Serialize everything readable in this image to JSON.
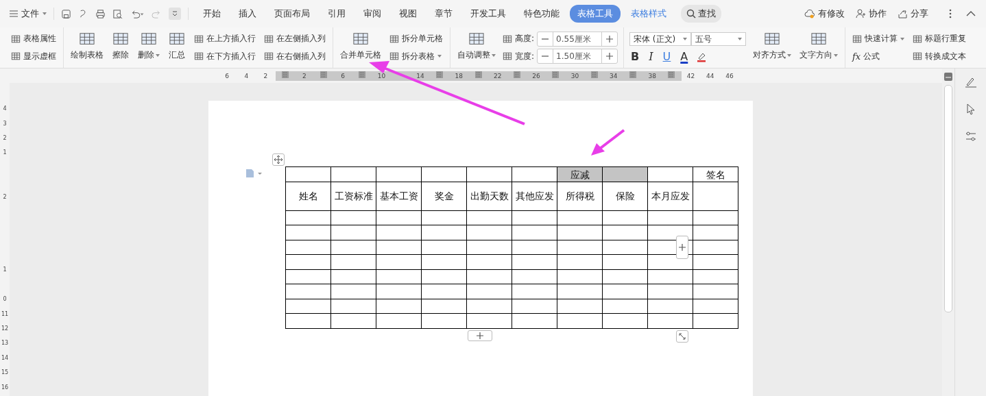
{
  "menu": {
    "file": "文件"
  },
  "tabs": [
    {
      "label": "开始",
      "selected": false,
      "contextual": false
    },
    {
      "label": "插入",
      "selected": false,
      "contextual": false
    },
    {
      "label": "页面布局",
      "selected": false,
      "contextual": false
    },
    {
      "label": "引用",
      "selected": false,
      "contextual": false
    },
    {
      "label": "审阅",
      "selected": false,
      "contextual": false
    },
    {
      "label": "视图",
      "selected": false,
      "contextual": false
    },
    {
      "label": "章节",
      "selected": false,
      "contextual": false
    },
    {
      "label": "开发工具",
      "selected": false,
      "contextual": false
    },
    {
      "label": "特色功能",
      "selected": false,
      "contextual": false
    },
    {
      "label": "表格工具",
      "selected": true,
      "contextual": true
    },
    {
      "label": "表格样式",
      "selected": false,
      "contextual": true
    }
  ],
  "search": {
    "label": "查找"
  },
  "actions": [
    "有修改",
    "协作",
    "分享"
  ],
  "ribbon": [
    {
      "columns": [
        {
          "kind": "stack",
          "items": [
            {
              "label": "表格属性"
            },
            {
              "label": "显示虚框"
            }
          ]
        }
      ]
    },
    {
      "columns": [
        {
          "kind": "large",
          "label": "绘制表格"
        },
        {
          "kind": "large",
          "label": "擦除"
        },
        {
          "kind": "large",
          "label": "删除",
          "dropdown": true
        },
        {
          "kind": "large",
          "label": "汇总"
        },
        {
          "kind": "stack",
          "items": [
            {
              "label": "在上方插入行"
            },
            {
              "label": "在下方插入行"
            }
          ]
        },
        {
          "kind": "stack",
          "items": [
            {
              "label": "在左侧插入列"
            },
            {
              "label": "在右侧插入列"
            }
          ]
        }
      ]
    },
    {
      "columns": [
        {
          "kind": "large",
          "label": "合并单元格"
        },
        {
          "kind": "stack",
          "items": [
            {
              "label": "拆分单元格"
            },
            {
              "label": "拆分表格",
              "dropdown": true
            }
          ]
        }
      ]
    },
    {
      "columns": [
        {
          "kind": "large",
          "label": "自动调整",
          "dropdown": true
        },
        {
          "kind": "spins",
          "items": [
            {
              "label": "高度:",
              "value": "0.55厘米"
            },
            {
              "label": "宽度:",
              "value": "1.50厘米"
            }
          ]
        }
      ]
    },
    {
      "columns": [
        {
          "kind": "font",
          "family": "宋体 (正文)",
          "size": "五号",
          "format": [
            "B",
            "I",
            "U",
            "A"
          ]
        },
        {
          "kind": "large",
          "label": "对齐方式",
          "dropdown": true
        },
        {
          "kind": "large",
          "label": "文字方向",
          "dropdown": true
        }
      ]
    },
    {
      "columns": [
        {
          "kind": "stack",
          "items": [
            {
              "label": "快速计算",
              "dropdown": true
            },
            {
              "label": "公式",
              "glyph": "fx"
            }
          ]
        },
        {
          "kind": "stack",
          "items": [
            {
              "label": "标题行重复"
            },
            {
              "label": "转换成文本"
            }
          ]
        }
      ]
    }
  ],
  "ruler": [
    {
      "kind": "number",
      "label": "6"
    },
    {
      "kind": "number",
      "label": "4"
    },
    {
      "kind": "number",
      "label": "2"
    },
    {
      "kind": "marker"
    },
    {
      "kind": "number",
      "label": "2"
    },
    {
      "kind": "marker"
    },
    {
      "kind": "number",
      "label": "6"
    },
    {
      "kind": "marker"
    },
    {
      "kind": "number",
      "label": "10"
    },
    {
      "kind": "blank"
    },
    {
      "kind": "number",
      "label": "14"
    },
    {
      "kind": "marker"
    },
    {
      "kind": "number",
      "label": "18"
    },
    {
      "kind": "marker"
    },
    {
      "kind": "number",
      "label": "22"
    },
    {
      "kind": "marker"
    },
    {
      "kind": "number",
      "label": "26"
    },
    {
      "kind": "marker"
    },
    {
      "kind": "number",
      "label": "30"
    },
    {
      "kind": "marker"
    },
    {
      "kind": "number",
      "label": "34"
    },
    {
      "kind": "marker"
    },
    {
      "kind": "number",
      "label": "38"
    },
    {
      "kind": "marker"
    },
    {
      "kind": "number",
      "label": "42"
    },
    {
      "kind": "number",
      "label": "44"
    },
    {
      "kind": "number",
      "label": "46"
    }
  ],
  "vruler": [
    {
      "kind": "number",
      "label": "4"
    },
    {
      "kind": "number",
      "label": "3"
    },
    {
      "kind": "number",
      "label": "2"
    },
    {
      "kind": "number",
      "label": "1"
    },
    {
      "kind": "blank"
    },
    {
      "kind": "blank"
    },
    {
      "kind": "number",
      "label": "2"
    },
    {
      "kind": "blank"
    },
    {
      "kind": "blank"
    },
    {
      "kind": "blank"
    },
    {
      "kind": "blank"
    },
    {
      "kind": "number",
      "label": "1"
    },
    {
      "kind": "blank"
    },
    {
      "kind": "number",
      "label": "0"
    },
    {
      "kind": "number",
      "label": "11"
    },
    {
      "kind": "number",
      "label": "12"
    },
    {
      "kind": "number",
      "label": "13"
    },
    {
      "kind": "number",
      "label": "14"
    },
    {
      "kind": "number",
      "label": "15"
    },
    {
      "kind": "number",
      "label": "16"
    }
  ],
  "table": {
    "rows": [
      {
        "cells": [
          {
            "shaded": false
          },
          {
            "shaded": false
          },
          {
            "shaded": false
          },
          {
            "shaded": false
          },
          {
            "shaded": false
          },
          {
            "shaded": false
          },
          {
            "text": "应减",
            "shaded": true
          },
          {
            "shaded": true
          },
          {
            "shaded": false
          },
          {
            "text": "签名",
            "shaded": false
          }
        ]
      },
      {
        "cells": [
          {
            "text": "姓名",
            "shaded": false
          },
          {
            "text": "工资标准",
            "shaded": false
          },
          {
            "text": "基本工资",
            "shaded": false
          },
          {
            "text": "奖金",
            "shaded": false
          },
          {
            "text": "出勤天数",
            "shaded": false
          },
          {
            "text": "其他应发",
            "shaded": false
          },
          {
            "text": "所得税",
            "shaded": false
          },
          {
            "text": "保险",
            "shaded": false
          },
          {
            "text": "本月应发",
            "shaded": false
          },
          {
            "shaded": false
          }
        ]
      },
      {
        "cells": [
          {
            "shaded": false
          },
          {
            "shaded": false
          },
          {
            "shaded": false
          },
          {
            "shaded": false
          },
          {
            "shaded": false
          },
          {
            "shaded": false
          },
          {
            "shaded": false
          },
          {
            "shaded": false
          },
          {
            "shaded": false
          },
          {
            "shaded": false
          }
        ]
      },
      {
        "cells": [
          {
            "shaded": false
          },
          {
            "shaded": false
          },
          {
            "shaded": false
          },
          {
            "shaded": false
          },
          {
            "shaded": false
          },
          {
            "shaded": false
          },
          {
            "shaded": false
          },
          {
            "shaded": false
          },
          {
            "shaded": false
          },
          {
            "shaded": false
          }
        ]
      },
      {
        "cells": [
          {
            "shaded": false
          },
          {
            "shaded": false
          },
          {
            "shaded": false
          },
          {
            "shaded": false
          },
          {
            "shaded": false
          },
          {
            "shaded": false
          },
          {
            "shaded": false
          },
          {
            "shaded": false
          },
          {
            "shaded": false
          },
          {
            "shaded": false
          }
        ]
      },
      {
        "cells": [
          {
            "shaded": false
          },
          {
            "shaded": false
          },
          {
            "shaded": false
          },
          {
            "shaded": false
          },
          {
            "shaded": false
          },
          {
            "shaded": false
          },
          {
            "shaded": false
          },
          {
            "shaded": false
          },
          {
            "shaded": false
          },
          {
            "shaded": false
          }
        ]
      },
      {
        "cells": [
          {
            "shaded": false
          },
          {
            "shaded": false
          },
          {
            "shaded": false
          },
          {
            "shaded": false
          },
          {
            "shaded": false
          },
          {
            "shaded": false
          },
          {
            "shaded": false
          },
          {
            "shaded": false
          },
          {
            "shaded": false
          },
          {
            "shaded": false
          }
        ]
      },
      {
        "cells": [
          {
            "shaded": false
          },
          {
            "shaded": false
          },
          {
            "shaded": false
          },
          {
            "shaded": false
          },
          {
            "shaded": false
          },
          {
            "shaded": false
          },
          {
            "shaded": false
          },
          {
            "shaded": false
          },
          {
            "shaded": false
          },
          {
            "shaded": false
          }
        ]
      },
      {
        "cells": [
          {
            "shaded": false
          },
          {
            "shaded": false
          },
          {
            "shaded": false
          },
          {
            "shaded": false
          },
          {
            "shaded": false
          },
          {
            "shaded": false
          },
          {
            "shaded": false
          },
          {
            "shaded": false
          },
          {
            "shaded": false
          },
          {
            "shaded": false
          }
        ]
      },
      {
        "cells": [
          {
            "shaded": false
          },
          {
            "shaded": false
          },
          {
            "shaded": false
          },
          {
            "shaded": false
          },
          {
            "shaded": false
          },
          {
            "shaded": false
          },
          {
            "shaded": false
          },
          {
            "shaded": false
          },
          {
            "shaded": false
          },
          {
            "shaded": false
          }
        ]
      }
    ]
  }
}
